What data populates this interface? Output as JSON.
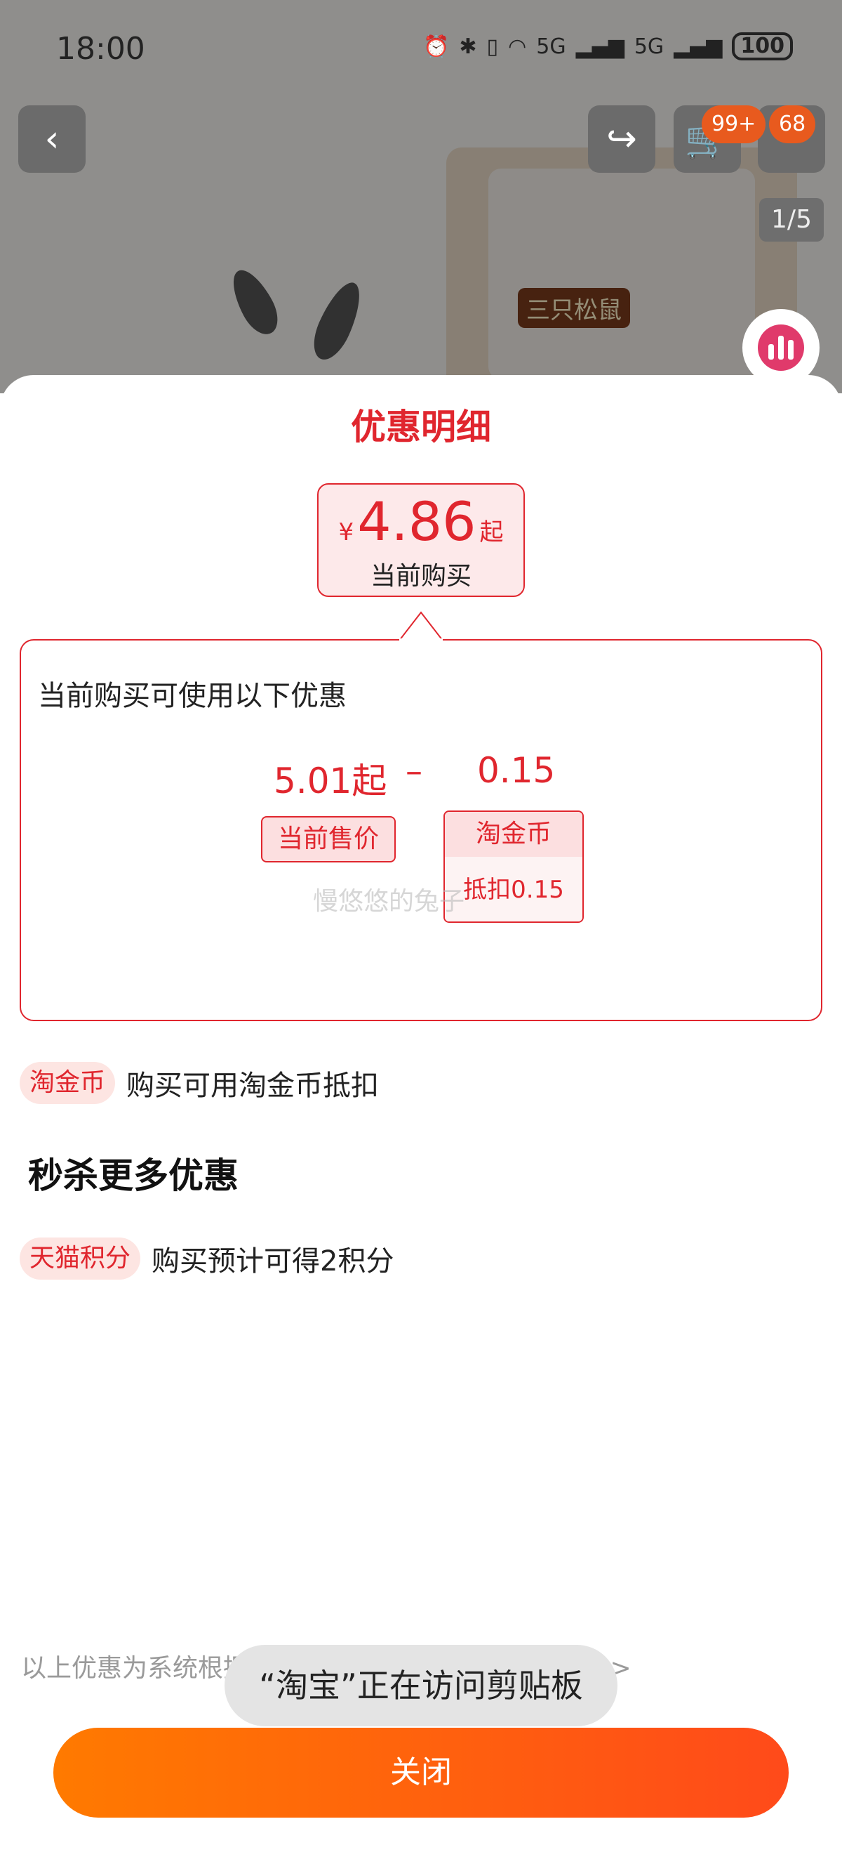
{
  "status_bar": {
    "time": "18:00",
    "network_labels": [
      "5G",
      "5G"
    ],
    "battery": "100"
  },
  "product_header": {
    "cart_badge": "99+",
    "message_badge": "68",
    "page_indicator": "1/5",
    "brand_label": "三只松鼠"
  },
  "sheet": {
    "title": "优惠明细",
    "price_box": {
      "currency": "¥",
      "value": "4.86",
      "suffix": "起",
      "caption": "当前购买"
    },
    "detail": {
      "heading": "当前购买可使用以下优惠",
      "price": "5.01起",
      "minus": "–",
      "discount": "0.15",
      "price_tag": "当前售价",
      "coin_tag_title": "淘金币",
      "coin_tag_value": "抵扣0.15",
      "watermark": "慢悠悠的兔子"
    },
    "promos": [
      {
        "tag": "淘金币",
        "text": "购买可用淘金币抵扣"
      },
      {
        "tag": "天猫积分",
        "text": "购买预计可得2积分"
      }
    ],
    "section_heading": "秒杀更多优惠",
    "footer_note": "以上优惠为系统根据商品信息计算的价格，查看详情 >",
    "toast": "“淘宝”正在访问剪贴板",
    "close_button": "关闭"
  },
  "colors": {
    "accent": "#e0262e",
    "button_gradient_start": "#ff7a00",
    "button_gradient_end": "#ff4a1a"
  }
}
